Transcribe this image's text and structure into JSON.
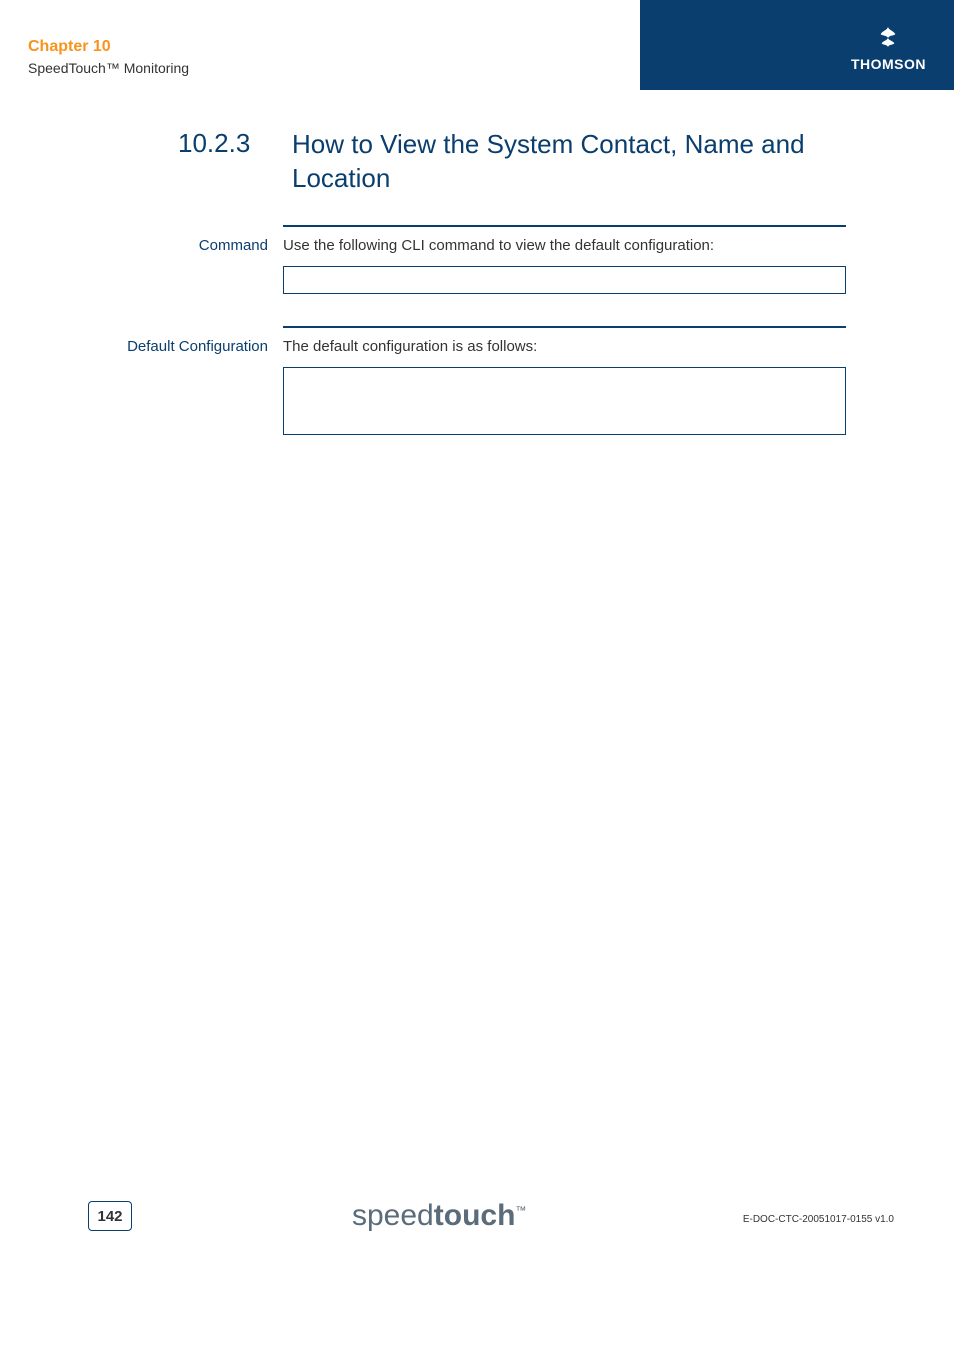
{
  "header": {
    "chapter": "Chapter 10",
    "subtitle": "SpeedTouch™ Monitoring",
    "brand": "THOMSON"
  },
  "section": {
    "number": "10.2.3",
    "title": "How to View the System Contact, Name and Location"
  },
  "rows": [
    {
      "label": "Command",
      "text": "Use the following CLI command to view the default configuration:",
      "box_height": "small"
    },
    {
      "label": "Default Configuration",
      "text": "The default configuration is as follows:",
      "box_height": "large"
    }
  ],
  "footer": {
    "page_number": "142",
    "product_logo_pre": "speed",
    "product_logo_bold": "touch",
    "product_logo_tm": "™",
    "doc_id": "E-DOC-CTC-20051017-0155 v1.0"
  }
}
